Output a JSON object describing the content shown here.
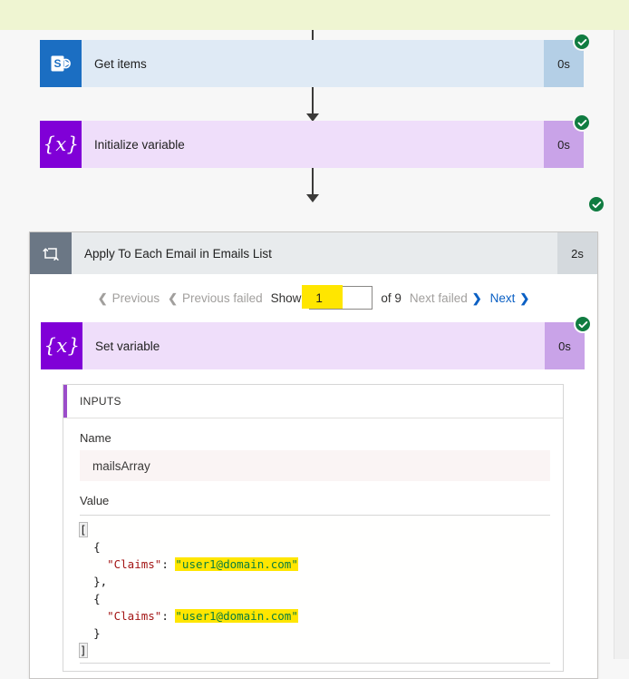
{
  "workflow": {
    "steps": [
      {
        "id": "get-items",
        "icon": "sharepoint-icon",
        "title": "Get items",
        "duration": "0s",
        "status": "succeeded"
      },
      {
        "id": "initialize-variable",
        "icon": "variable-braces-icon",
        "title": "Initialize variable",
        "duration": "0s",
        "status": "succeeded"
      },
      {
        "id": "apply-to-each",
        "icon": "foreach-loop-icon",
        "title": "Apply To Each Email in Emails List",
        "duration": "2s",
        "status": "succeeded"
      },
      {
        "id": "set-variable",
        "icon": "variable-braces-icon",
        "title": "Set variable",
        "duration": "0s",
        "status": "succeeded"
      }
    ]
  },
  "pager": {
    "previous_label": "Previous",
    "previous_failed_label": "Previous failed",
    "show_label": "Show",
    "current_page": "1",
    "of_label": "of 9",
    "next_failed_label": "Next failed",
    "next_label": "Next",
    "chevron_left": "‹",
    "chevron_right": "›"
  },
  "inputs": {
    "section_title": "INPUTS",
    "name_label": "Name",
    "name_value": "mailsArray",
    "value_label": "Value",
    "code_lines": [
      {
        "indent": 0,
        "parts": [
          {
            "t": "[",
            "k": "punct",
            "caret": true
          }
        ]
      },
      {
        "indent": 1,
        "parts": [
          {
            "t": "{",
            "k": "punct"
          }
        ]
      },
      {
        "indent": 2,
        "parts": [
          {
            "t": "\"Claims\"",
            "k": "key"
          },
          {
            "t": ": ",
            "k": "punct"
          },
          {
            "t": "\"user1@domain.com\"",
            "k": "str",
            "hl": true
          }
        ]
      },
      {
        "indent": 1,
        "parts": [
          {
            "t": "},",
            "k": "punct"
          }
        ]
      },
      {
        "indent": 1,
        "parts": [
          {
            "t": "{",
            "k": "punct"
          }
        ]
      },
      {
        "indent": 2,
        "parts": [
          {
            "t": "\"Claims\"",
            "k": "key"
          },
          {
            "t": ": ",
            "k": "punct"
          },
          {
            "t": "\"user1@domain.com\"",
            "k": "str",
            "hl": true
          }
        ]
      },
      {
        "indent": 1,
        "parts": [
          {
            "t": "}",
            "k": "punct"
          }
        ]
      },
      {
        "indent": 0,
        "parts": [
          {
            "t": "]",
            "k": "punct",
            "caret": true
          }
        ]
      }
    ]
  },
  "colors": {
    "top_band": "#eff5d2",
    "sharepoint": "#1b6ec2",
    "variable_purple": "#8000d7",
    "loop_gray": "#6b7785",
    "success_green": "#107c41",
    "link_blue": "#0b60c4",
    "highlight_yellow": "#ffe600",
    "json_key": "#a31515",
    "json_string": "#0b7d3e"
  }
}
